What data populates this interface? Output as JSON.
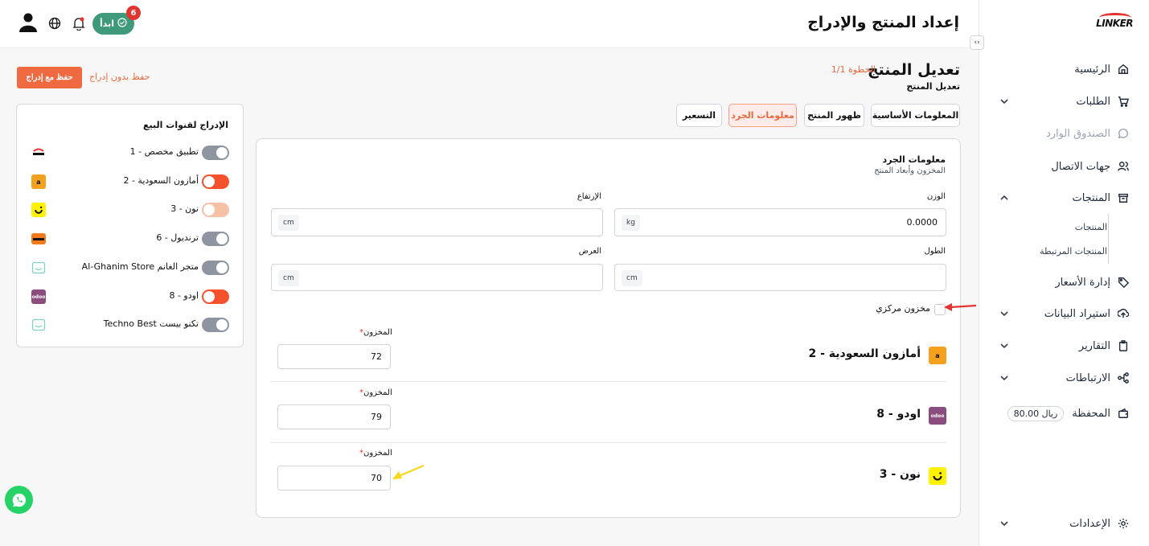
{
  "header": {
    "title": "إعداد المنتج والإدراج",
    "start_button": "ابدأ",
    "start_badge": "6"
  },
  "sidebar": {
    "logo_text": "LINKER",
    "items": [
      {
        "label": "الرئيسية",
        "icon": "home-icon"
      },
      {
        "label": "الطلبات",
        "icon": "cart-icon"
      },
      {
        "label": "الصندوق الوارد",
        "icon": "chat-icon"
      },
      {
        "label": "جهات الاتصال",
        "icon": "contacts-icon"
      },
      {
        "label": "المنتجات",
        "icon": "box-icon"
      },
      {
        "label": "إدارة الأسعار",
        "icon": "tag-icon"
      },
      {
        "label": "استيراد البيانات",
        "icon": "upload-icon"
      },
      {
        "label": "التقارير",
        "icon": "clipboard-icon"
      },
      {
        "label": "الارتباطات",
        "icon": "share-icon"
      },
      {
        "label": "المحفظة",
        "icon": "wallet-icon"
      },
      {
        "label": "الإعدادات",
        "icon": "gear-icon"
      }
    ],
    "products_sub": [
      "المنتجات",
      "المنتجات المرتبطة"
    ],
    "wallet_balance": "80.00 ريال"
  },
  "main": {
    "title": "تعديل المنتج",
    "step": "الخطوة 1/1",
    "subtitle": "تعديل المنتج",
    "save_with_listing": "حفظ مع إدراج",
    "save_without_listing": "حفظ بدون إدراج",
    "tabs": [
      {
        "label": "المعلومات الأساسية",
        "active": false
      },
      {
        "label": "ظهور المنتج",
        "active": false
      },
      {
        "label": "معلومات الجرد",
        "active": true
      },
      {
        "label": "التسعير",
        "active": false
      }
    ]
  },
  "channels": {
    "title": "الإدراج لقنوات البيع",
    "items": [
      {
        "label": "تطبيق مخصص - 1",
        "logo": "linker-logo",
        "enabled": false,
        "state": "off"
      },
      {
        "label": "أمازون السعودية - 2",
        "logo": "amazon-logo",
        "enabled": true,
        "state": "on"
      },
      {
        "label": "نون - 3",
        "logo": "noon-logo",
        "enabled": true,
        "state": "partial"
      },
      {
        "label": "ترنديول - 6",
        "logo": "trendyol-logo",
        "enabled": false,
        "state": "off"
      },
      {
        "label": "Al-Ghanim Store متجر الغانم",
        "logo": "store-logo",
        "enabled": false,
        "state": "off"
      },
      {
        "label": "اودو - 8",
        "logo": "odoo-logo",
        "enabled": true,
        "state": "on"
      },
      {
        "label": "Techno Best تكنو بيست",
        "logo": "store-logo",
        "enabled": false,
        "state": "off"
      }
    ]
  },
  "inventory": {
    "title": "معلومات الجرد",
    "subtitle": "المخزون وأبعاد المنتج",
    "weight": {
      "label": "الوزن",
      "value": "0.0000",
      "unit": "kg"
    },
    "height": {
      "label": "الإرتفاع",
      "value": "",
      "unit": "cm"
    },
    "length": {
      "label": "الطول",
      "value": "",
      "unit": "cm"
    },
    "width": {
      "label": "العرض",
      "value": "",
      "unit": "cm"
    },
    "central_stock_label": "مخزون مركزي",
    "stock_rows": [
      {
        "name": "أمازون السعودية - 2",
        "logo": "amazon-logo",
        "label": "المخزون",
        "value": "72"
      },
      {
        "name": "اودو - 8",
        "logo": "odoo-logo",
        "label": "المخزون",
        "value": "79"
      },
      {
        "name": "نون - 3",
        "logo": "noon-logo",
        "label": "المخزون",
        "value": "70"
      }
    ]
  },
  "colors": {
    "accent": "#f06a41",
    "brand_green": "#3e9a7b",
    "toggle_on": "#f4512c",
    "toggle_off": "#8e94a0",
    "toggle_partial": "#f7c1a8"
  }
}
